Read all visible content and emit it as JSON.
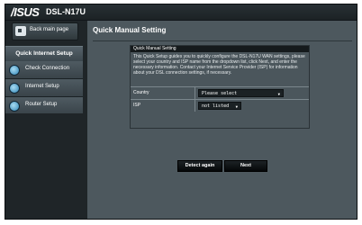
{
  "header": {
    "logo": "/ISUS",
    "model": "DSL-N17U"
  },
  "sidebar": {
    "back_label": "Back main page",
    "section_title": "Quick Internet Setup",
    "items": [
      {
        "label": "Check Connection",
        "icon": "globe-icon"
      },
      {
        "label": "Internet Setup",
        "icon": "globe-icon"
      },
      {
        "label": "Router Setup",
        "icon": "globe-icon"
      }
    ]
  },
  "main": {
    "title": "Quick Manual Setting",
    "panel": {
      "title": "Quick Manual Setting",
      "description": "This Quick Setup guides you to quickly configure the DSL-N17U WAN settings, please select your country and ISP name from the dropdown list, click Next, and enter the necessary information. Contact your Internet Service Provider (ISP) for information about your DSL connection settings, if necessary.",
      "country_label": "Country",
      "country_value": "Please select",
      "isp_label": "ISP",
      "isp_value": "not listed"
    },
    "buttons": {
      "detect_label": "Detect again",
      "next_label": "Next"
    }
  },
  "colors": {
    "page_background": "#1f2528",
    "content_background": "#4d585e",
    "panel_header": "#151a1c",
    "button": "#0c0f11"
  }
}
